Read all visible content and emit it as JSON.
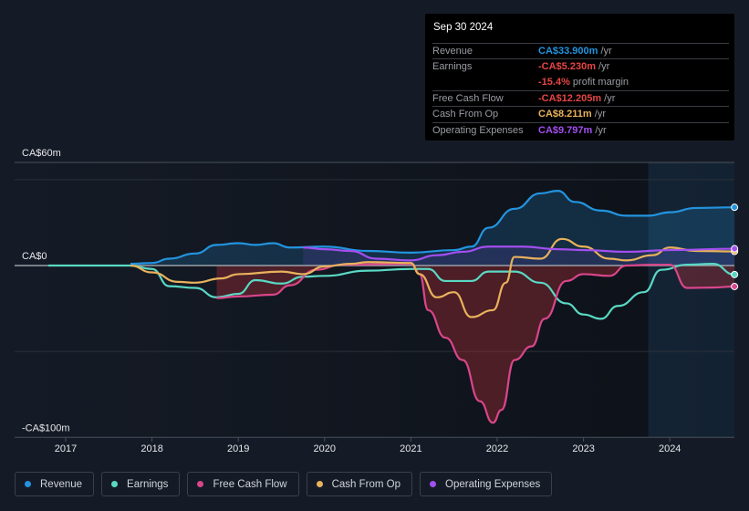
{
  "tooltip": {
    "date": "Sep 30 2024",
    "rows": [
      {
        "label": "Revenue",
        "value": "CA$33.900m",
        "unit": " /yr",
        "color": "#2394df"
      },
      {
        "label": "Earnings",
        "value": "-CA$5.230m",
        "unit": " /yr",
        "color": "#e64545"
      },
      {
        "label": "",
        "value": "-15.4%",
        "unit": " profit margin",
        "color": "#e64545"
      },
      {
        "label": "Free Cash Flow",
        "value": "-CA$12.205m",
        "unit": " /yr",
        "color": "#e64545"
      },
      {
        "label": "Cash From Op",
        "value": "CA$8.211m",
        "unit": " /yr",
        "color": "#e8b25c"
      },
      {
        "label": "Operating Expenses",
        "value": "CA$9.797m",
        "unit": " /yr",
        "color": "#a34ff0"
      }
    ]
  },
  "chart_data": {
    "type": "line",
    "y_tick_labels": [
      "CA$60m",
      "CA$0",
      "-CA$100m"
    ],
    "y_ticks": [
      60,
      0,
      -100
    ],
    "ylim": [
      -100,
      60
    ],
    "xlim": [
      2016.55,
      2024.8
    ],
    "x_tick_labels": [
      "2017",
      "2018",
      "2019",
      "2020",
      "2021",
      "2022",
      "2023",
      "2024"
    ],
    "x_ticks": [
      2017,
      2018,
      2019,
      2020,
      2021,
      2022,
      2023,
      2024
    ],
    "forecast_start": 2023.75,
    "series": [
      {
        "name": "Revenue",
        "color": "#2394df",
        "fill": true,
        "points": [
          [
            2017.75,
            1
          ],
          [
            2018,
            1.5
          ],
          [
            2018.2,
            4
          ],
          [
            2018.5,
            7
          ],
          [
            2018.75,
            12
          ],
          [
            2019,
            13
          ],
          [
            2019.2,
            12
          ],
          [
            2019.4,
            13
          ],
          [
            2019.6,
            10.5
          ],
          [
            2020,
            11
          ],
          [
            2020.5,
            8.5
          ],
          [
            2021,
            7.5
          ],
          [
            2021.5,
            9
          ],
          [
            2021.7,
            11
          ],
          [
            2021.9,
            22
          ],
          [
            2022.2,
            33
          ],
          [
            2022.5,
            42
          ],
          [
            2022.7,
            43.5
          ],
          [
            2022.9,
            37
          ],
          [
            2023.2,
            32
          ],
          [
            2023.5,
            29
          ],
          [
            2023.75,
            29
          ],
          [
            2024,
            31
          ],
          [
            2024.3,
            33.5
          ],
          [
            2024.75,
            33.9
          ]
        ]
      },
      {
        "name": "Earnings",
        "color": "#5ad8c4",
        "fill": false,
        "points": [
          [
            2016.8,
            0
          ],
          [
            2017.75,
            0
          ],
          [
            2018,
            -2
          ],
          [
            2018.2,
            -12
          ],
          [
            2018.5,
            -13
          ],
          [
            2018.75,
            -18.5
          ],
          [
            2019,
            -16.5
          ],
          [
            2019.2,
            -8.5
          ],
          [
            2019.5,
            -10.5
          ],
          [
            2019.75,
            -6.5
          ],
          [
            2020,
            -6
          ],
          [
            2020.5,
            -3
          ],
          [
            2021,
            -2
          ],
          [
            2021.2,
            -2
          ],
          [
            2021.4,
            -9
          ],
          [
            2021.7,
            -9
          ],
          [
            2021.9,
            -3.5
          ],
          [
            2022.2,
            -3.5
          ],
          [
            2022.5,
            -10
          ],
          [
            2022.8,
            -22
          ],
          [
            2023,
            -28.5
          ],
          [
            2023.2,
            -31
          ],
          [
            2023.4,
            -23.5
          ],
          [
            2023.7,
            -15.5
          ],
          [
            2023.9,
            -2.5
          ],
          [
            2024.2,
            0.5
          ],
          [
            2024.5,
            1
          ],
          [
            2024.75,
            -5.23
          ]
        ]
      },
      {
        "name": "Free Cash Flow",
        "color": "#d9468a",
        "fill": true,
        "points": [
          [
            2018.75,
            -19
          ],
          [
            2019,
            -18
          ],
          [
            2019.4,
            -17
          ],
          [
            2019.6,
            -11.5
          ],
          [
            2019.9,
            -2.5
          ],
          [
            2020.2,
            0.5
          ],
          [
            2021,
            1
          ],
          [
            2021.1,
            -5
          ],
          [
            2021.2,
            -26
          ],
          [
            2021.4,
            -42
          ],
          [
            2021.6,
            -55
          ],
          [
            2021.8,
            -79
          ],
          [
            2021.95,
            -91.5
          ],
          [
            2022.05,
            -84
          ],
          [
            2022.2,
            -55
          ],
          [
            2022.4,
            -47
          ],
          [
            2022.55,
            -31
          ],
          [
            2022.8,
            -9
          ],
          [
            2023,
            -5
          ],
          [
            2023.3,
            -6
          ],
          [
            2023.5,
            0
          ],
          [
            2023.8,
            0.5
          ],
          [
            2024,
            0.5
          ],
          [
            2024.2,
            -13
          ],
          [
            2024.5,
            -12.8
          ],
          [
            2024.75,
            -12.2
          ]
        ]
      },
      {
        "name": "Cash From Op",
        "color": "#e8b25c",
        "fill": false,
        "points": [
          [
            2017.75,
            0
          ],
          [
            2018,
            -4
          ],
          [
            2018.3,
            -9.5
          ],
          [
            2018.5,
            -10
          ],
          [
            2018.8,
            -7.5
          ],
          [
            2019,
            -5
          ],
          [
            2019.5,
            -3.5
          ],
          [
            2019.75,
            -5
          ],
          [
            2020,
            -0.5
          ],
          [
            2020.3,
            1
          ],
          [
            2020.5,
            2
          ],
          [
            2021,
            1.5
          ],
          [
            2021.1,
            -5
          ],
          [
            2021.3,
            -18.5
          ],
          [
            2021.5,
            -15.5
          ],
          [
            2021.7,
            -30
          ],
          [
            2021.95,
            -26
          ],
          [
            2022.1,
            -10
          ],
          [
            2022.2,
            5
          ],
          [
            2022.5,
            4
          ],
          [
            2022.75,
            15.5
          ],
          [
            2023,
            11
          ],
          [
            2023.3,
            4
          ],
          [
            2023.5,
            3
          ],
          [
            2023.8,
            6
          ],
          [
            2024,
            10.5
          ],
          [
            2024.3,
            8.5
          ],
          [
            2024.75,
            8.2
          ]
        ]
      },
      {
        "name": "Operating Expenses",
        "color": "#a34ff0",
        "fill": true,
        "points": [
          [
            2019.75,
            10.5
          ],
          [
            2020,
            9.5
          ],
          [
            2020.3,
            8.5
          ],
          [
            2020.6,
            4
          ],
          [
            2021,
            3
          ],
          [
            2021.3,
            6
          ],
          [
            2021.6,
            8
          ],
          [
            2021.9,
            11
          ],
          [
            2022.3,
            11
          ],
          [
            2022.7,
            9.5
          ],
          [
            2023,
            9
          ],
          [
            2023.5,
            8
          ],
          [
            2024,
            9
          ],
          [
            2024.75,
            9.8
          ]
        ]
      }
    ]
  },
  "legend": [
    {
      "label": "Revenue",
      "color": "#2394df"
    },
    {
      "label": "Earnings",
      "color": "#5ad8c4"
    },
    {
      "label": "Free Cash Flow",
      "color": "#d9468a"
    },
    {
      "label": "Cash From Op",
      "color": "#e8b25c"
    },
    {
      "label": "Operating Expenses",
      "color": "#a34ff0"
    }
  ]
}
